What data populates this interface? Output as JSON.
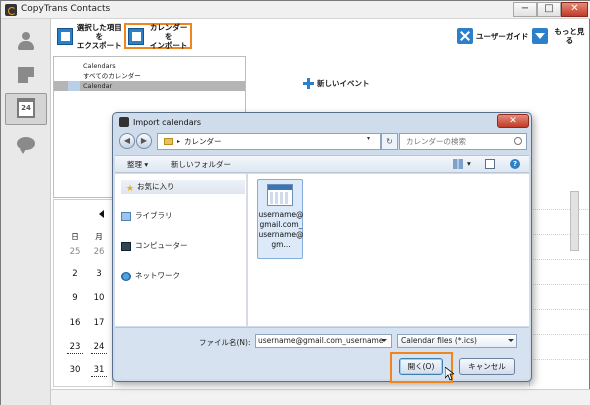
{
  "window": {
    "title": "CopyTrans Contacts",
    "controls": {
      "minimize": "−",
      "maximize": "□",
      "close": "✕"
    }
  },
  "sidebar": {
    "items": [
      {
        "name": "contacts",
        "icon": "person-icon"
      },
      {
        "name": "notes",
        "icon": "note-icon"
      },
      {
        "name": "calendar",
        "icon": "calendar-icon",
        "label": "24"
      },
      {
        "name": "messages",
        "icon": "chat-bubble-icon"
      }
    ]
  },
  "toolbar": {
    "export_line1": "選択した項目を",
    "export_line2": "エクスポート",
    "import_line1": "カレンダーを",
    "import_line2": "インポート",
    "guide_label": "ユーザーガイド",
    "more_label": "もっと見る"
  },
  "calendars": {
    "header": "Calendars",
    "items": [
      "すべてのカレンダー",
      "Calendar"
    ]
  },
  "new_event": {
    "label": "新しいイベント"
  },
  "mini_calendar": {
    "day_headers": [
      "日",
      "月"
    ],
    "rows": [
      [
        "25",
        "26"
      ],
      [
        "2",
        "3"
      ],
      [
        "9",
        "10"
      ],
      [
        "16",
        "17"
      ],
      [
        "23",
        "24"
      ],
      [
        "30",
        "31"
      ]
    ],
    "gray_rows": [
      0
    ],
    "underlined": [
      [
        4,
        0
      ],
      [
        4,
        1
      ],
      [
        5,
        1
      ]
    ]
  },
  "dialog": {
    "title": "Import calendars",
    "close": "✕",
    "address": {
      "folder": "カレンダー",
      "separator": "▸"
    },
    "search_placeholder": "カレンダーの検索",
    "commands": {
      "organize": "整理 ▾",
      "new_folder": "新しいフォルダー",
      "views": "▾",
      "help": "?"
    },
    "navigation": {
      "favorites": "お気に入り",
      "items": [
        "ライブラリ",
        "コンピューター",
        "ネットワーク"
      ]
    },
    "file": {
      "name": "username@gmail.com_username@gm..."
    },
    "filename_label": "ファイル名(N):",
    "filename_value": "username@gmail.com_username",
    "filetype_value": "Calendar files (*.ics)",
    "open_label": "開く(O)",
    "cancel_label": "キャンセル"
  },
  "colors": {
    "accent_blue": "#2c7fc9",
    "highlight_orange": "#f0851e",
    "dialog_chrome": "#cfdcec",
    "selected_row": "#b5b5b5"
  }
}
